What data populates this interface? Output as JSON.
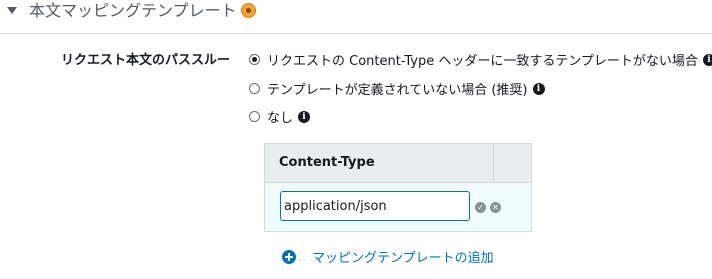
{
  "section": {
    "title": "本文マッピングテンプレート",
    "info_icon": "info-icon"
  },
  "passthrough": {
    "label": "リクエスト本文のパススルー",
    "options": [
      {
        "label": "リクエストの Content-Type ヘッダーに一致するテンプレートがない場合",
        "selected": true
      },
      {
        "label": "テンプレートが定義されていない場合 (推奨)",
        "selected": false
      },
      {
        "label": "なし",
        "selected": false
      }
    ]
  },
  "table": {
    "header": "Content-Type",
    "input_value": "application/json",
    "confirm_icon": "check-icon",
    "cancel_icon": "close-icon"
  },
  "add_link": {
    "label": "マッピングテンプレートの追加"
  },
  "colors": {
    "link": "#0073bb",
    "info_accent": "#f2a33a",
    "row_highlight": "#f1faff"
  }
}
